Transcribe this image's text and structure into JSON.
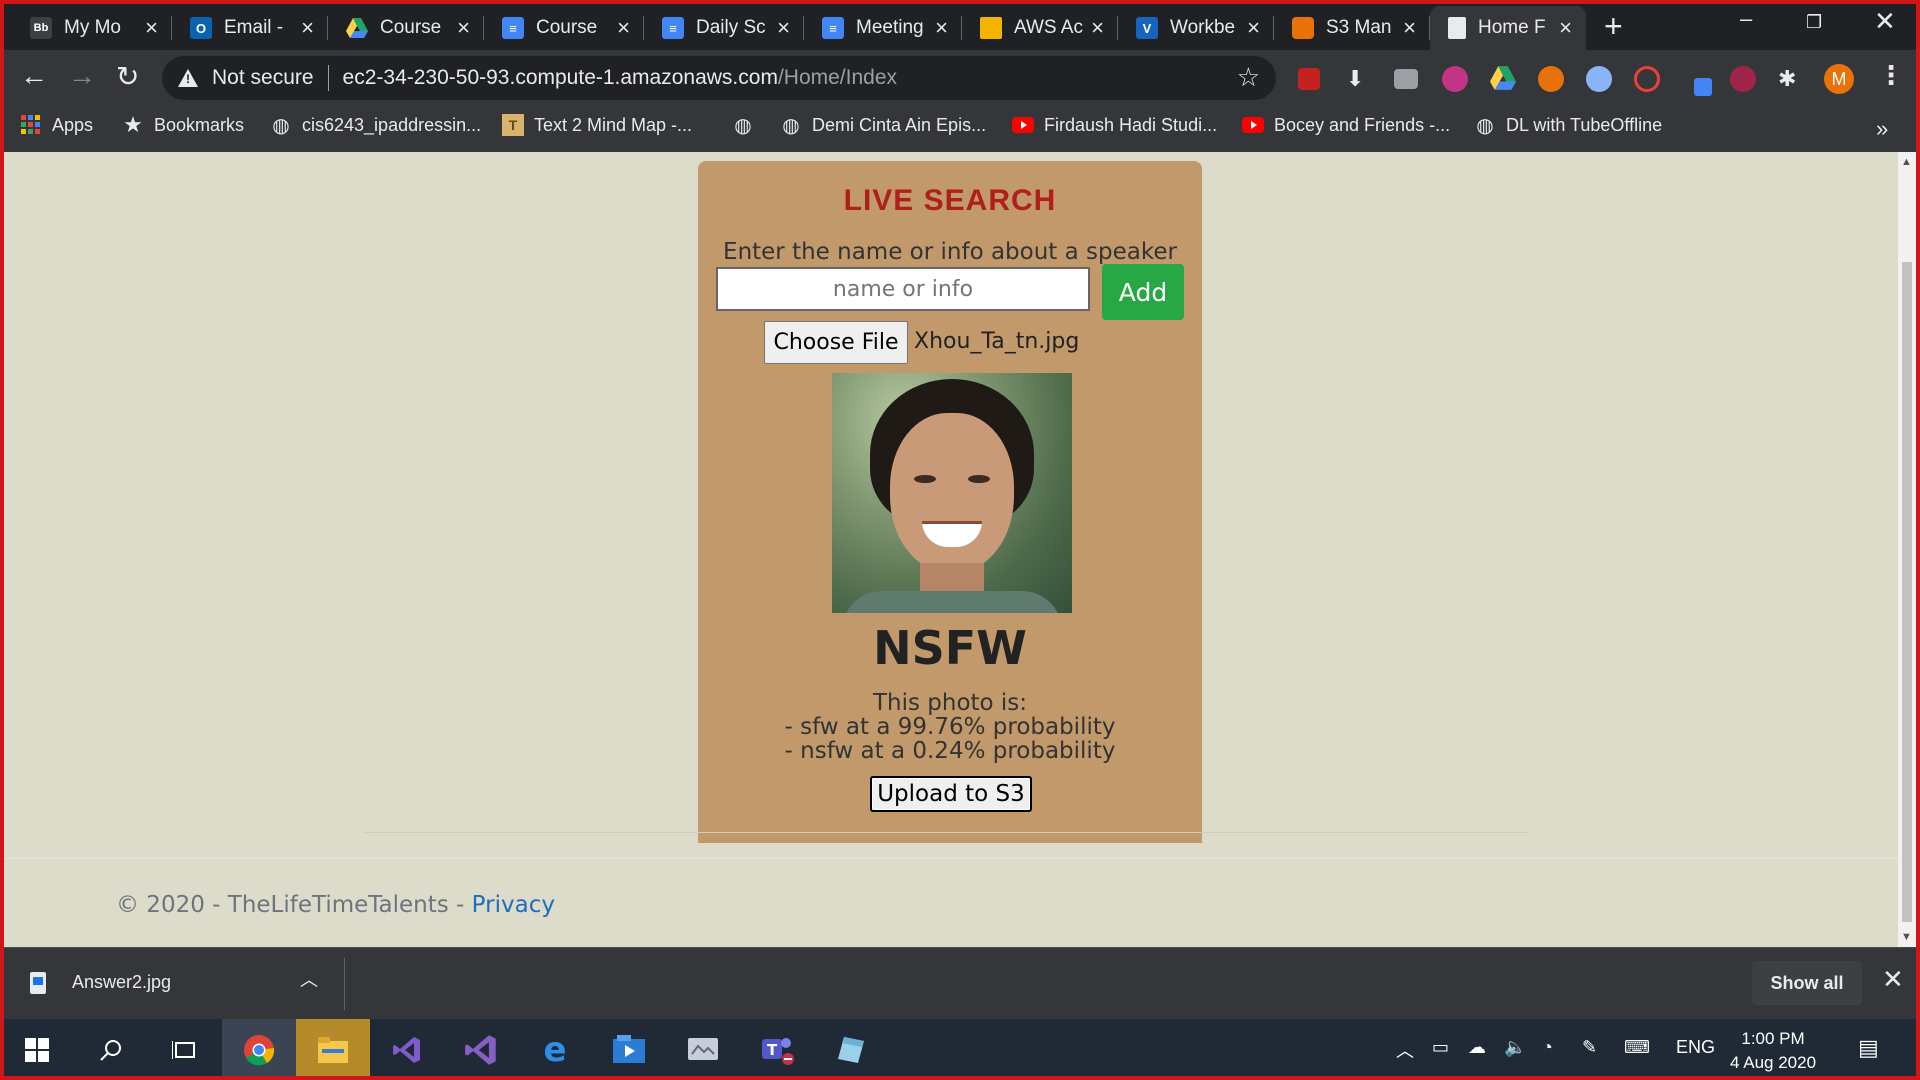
{
  "browser": {
    "tabs": [
      {
        "title": "My Mo",
        "icon": "blackboard-icon",
        "color": "#3c4043"
      },
      {
        "title": "Email -",
        "icon": "outlook-icon",
        "color": "#0a64ad"
      },
      {
        "title": "Course",
        "icon": "google-drive-icon",
        "color": "#1fa463"
      },
      {
        "title": "Course",
        "icon": "google-docs-icon",
        "color": "#4285f4"
      },
      {
        "title": "Daily Sc",
        "icon": "google-docs-icon",
        "color": "#4285f4"
      },
      {
        "title": "Meeting",
        "icon": "google-docs-icon",
        "color": "#4285f4"
      },
      {
        "title": "AWS Ac",
        "icon": "aws-box-icon",
        "color": "#f4b400"
      },
      {
        "title": "Workbe",
        "icon": "vocareum-icon",
        "color": "#1565c0"
      },
      {
        "title": "S3 Man",
        "icon": "aws-s3-icon",
        "color": "#e8710a"
      },
      {
        "title": "Home F",
        "icon": "page-icon",
        "color": "#e8eaed"
      }
    ],
    "active_tab_index": 9,
    "address": {
      "security_label": "Not secure",
      "host": "ec2-34-230-50-93.compute-1.amazonaws.com",
      "path": "/Home/Index"
    },
    "profile_initial": "M",
    "bookmarks": [
      {
        "label": "Apps",
        "icon": "apps-grid-icon"
      },
      {
        "label": "Bookmarks",
        "icon": "star-icon"
      },
      {
        "label": "cis6243_ipaddressin...",
        "icon": "globe-icon"
      },
      {
        "label": "Text 2 Mind Map -...",
        "icon": "text2mindmap-icon"
      },
      {
        "label": "",
        "icon": "globe-icon"
      },
      {
        "label": "Demi Cinta Ain Epis...",
        "icon": "globe-icon"
      },
      {
        "label": "Firdaush Hadi Studi...",
        "icon": "youtube-icon"
      },
      {
        "label": "Bocey and Friends -...",
        "icon": "youtube-icon"
      },
      {
        "label": "DL with TubeOffline",
        "icon": "globe-icon"
      }
    ]
  },
  "page": {
    "background": "#dddbc9",
    "panel": {
      "title": "LIVE SEARCH",
      "prompt": "Enter the name or info about a speaker",
      "search_placeholder": "name or info",
      "add_label": "Add",
      "choose_file_label": "Choose File",
      "file_name": "Xhou_Ta_tn.jpg",
      "photo_alt": "speaker photo",
      "verdict": "NSFW",
      "result_heading": "This photo is:",
      "result_line1": "- sfw at a 99.76% probability",
      "result_line2": "- nsfw at a 0.24% probability",
      "upload_label": "Upload to S3"
    },
    "footer": {
      "copyright": "© 2020 - TheLifeTimeTalents - ",
      "privacy_link": "Privacy"
    }
  },
  "downloads": {
    "file_name": "Answer2.jpg",
    "show_all_label": "Show all"
  },
  "taskbar": {
    "apps": [
      "start-icon",
      "search-icon",
      "task-view-icon",
      "chrome-icon",
      "file-explorer-icon",
      "visual-studio-code-icon",
      "visual-studio-icon",
      "edge-icon",
      "media-player-icon",
      "photos-icon",
      "teams-icon",
      "notepad-icon"
    ],
    "language": "ENG",
    "time": "1:00 PM",
    "date": "4 Aug 2020"
  }
}
